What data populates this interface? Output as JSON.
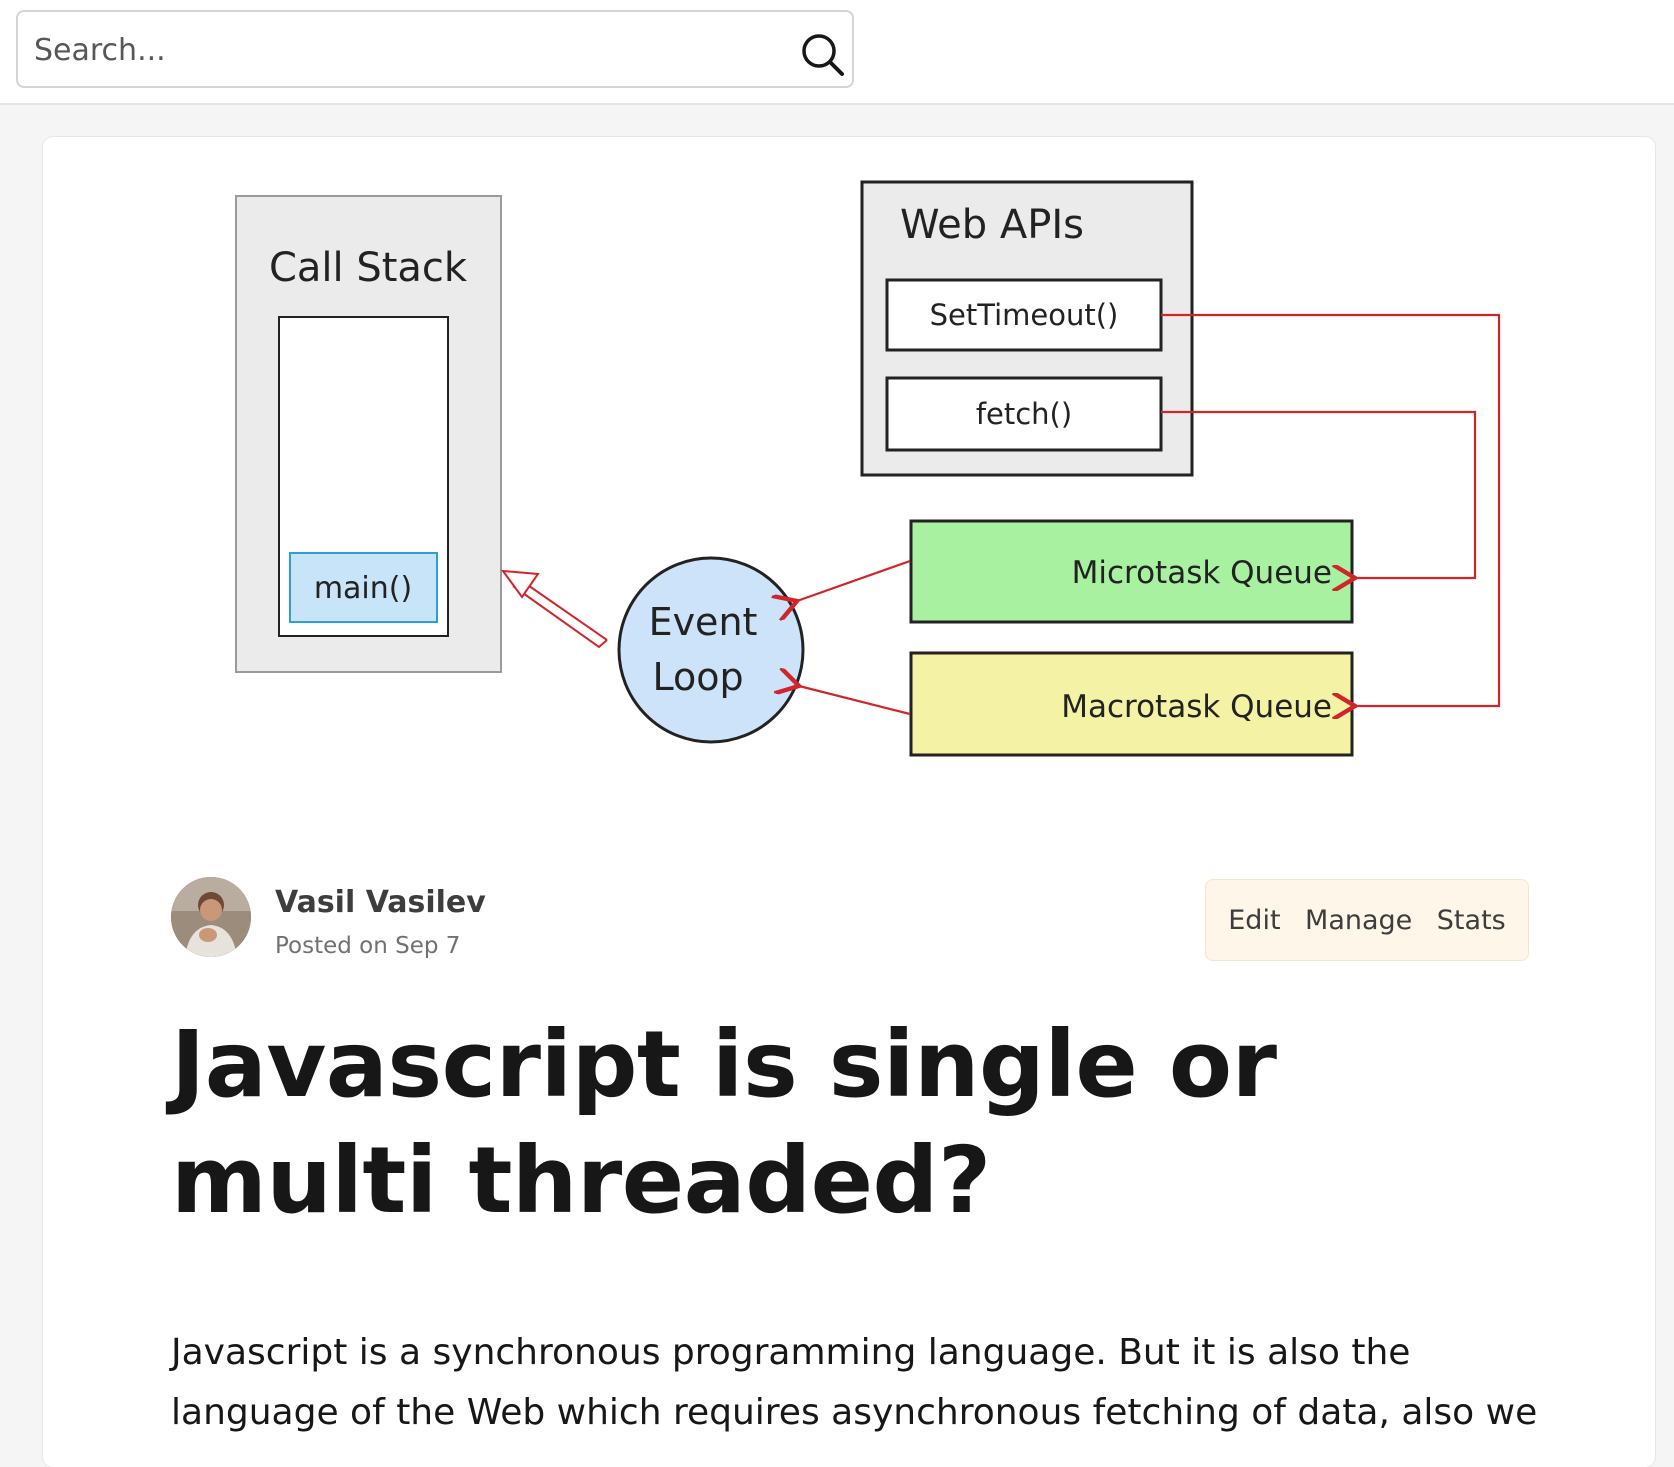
{
  "search": {
    "placeholder": "Search..."
  },
  "diagram": {
    "call_stack": {
      "title": "Call Stack",
      "item": "main()"
    },
    "web_apis": {
      "title": "Web APIs",
      "items": [
        "SetTimeout()",
        "fetch()"
      ]
    },
    "event_loop": {
      "line1": "Event",
      "line2": "Loop"
    },
    "microtask_queue": "Microtask Queue",
    "macrotask_queue": "Macrotask Queue",
    "colors": {
      "box_gray": "#ebebeb",
      "main_blue": "#c8e4f8",
      "loop_blue": "#cde3fa",
      "micro_green": "#a8f1a0",
      "macro_yellow": "#f4f2a4",
      "arrow_red": "#d0262b"
    }
  },
  "author": {
    "name": "Vasil Vasilev",
    "posted": "Posted on Sep 7"
  },
  "actions": {
    "edit": "Edit",
    "manage": "Manage",
    "stats": "Stats"
  },
  "article": {
    "title": "Javascript is single or multi threaded?",
    "intro": "Javascript is a synchronous programming language. But it is also the language of the Web which requires asynchronous fetching of data, also we"
  }
}
